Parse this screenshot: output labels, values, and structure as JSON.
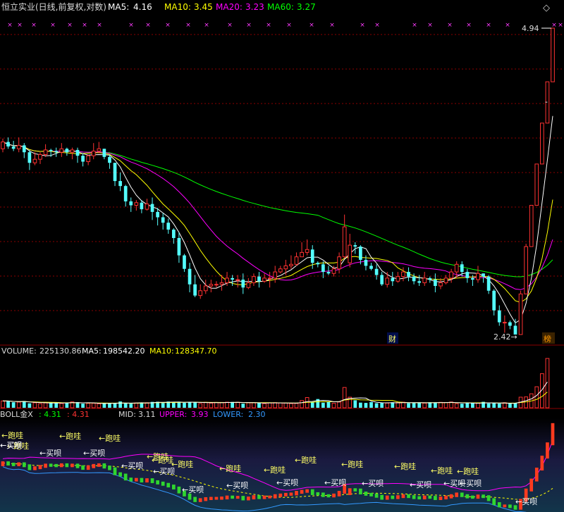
{
  "main_header": {
    "title": "恒立实业(日线,前复权,对数)",
    "ma5_label": "MA5:",
    "ma5_value": "4.16",
    "ma10_label": "MA10:",
    "ma10_value": "3.45",
    "ma20_label": "MA20:",
    "ma20_value": "3.23",
    "ma60_label": "MA60:",
    "ma60_value": "3.27"
  },
  "window_button": "◇",
  "annotations": {
    "high_label": "4.94",
    "low_label": "2.42→",
    "marker_cai": "财",
    "marker_bang": "榜",
    "dash_mark": "-"
  },
  "volume_header": {
    "label": "VOLUME:",
    "value": "225130.86",
    "ma5_label": "MA5:",
    "ma5_value": "198542.20",
    "ma10_label": "MA10:",
    "ma10_value": "128347.70"
  },
  "boll_header": {
    "label": "BOLL金X",
    "v1": ": 4.31",
    "v2": ": 4.31",
    "mid_label": "MID:",
    "mid_value": "3.11",
    "upper_label": "UPPER:",
    "upper_value": "3.93",
    "lower_label": "LOWER:",
    "lower_value": "2.30"
  },
  "boll_signals": [
    {
      "text": "←跑哇",
      "kind": "sell"
    },
    {
      "text": "←跑哇",
      "kind": "sell"
    },
    {
      "text": "←跑哇",
      "kind": "sell"
    },
    {
      "text": "←跑哇",
      "kind": "sell"
    },
    {
      "text": "←跑哇",
      "kind": "sell"
    },
    {
      "text": "←跑哇",
      "kind": "sell"
    },
    {
      "text": "←跑哇",
      "kind": "sell"
    },
    {
      "text": "←跑哇",
      "kind": "sell"
    },
    {
      "text": "←跑哇",
      "kind": "sell"
    },
    {
      "text": "←跑哇",
      "kind": "sell"
    },
    {
      "text": "←跑哇",
      "kind": "sell"
    },
    {
      "text": "←跑哇",
      "kind": "sell"
    },
    {
      "text": "←跑哇",
      "kind": "sell"
    },
    {
      "text": "←跑哇",
      "kind": "sell"
    },
    {
      "text": "←买呗",
      "kind": "buy"
    },
    {
      "text": "←买呗",
      "kind": "buy"
    },
    {
      "text": "←买呗",
      "kind": "buy"
    },
    {
      "text": "←买呗",
      "kind": "buy"
    },
    {
      "text": "←买呗",
      "kind": "buy"
    },
    {
      "text": "←买呗",
      "kind": "buy"
    },
    {
      "text": "←买呗",
      "kind": "buy"
    },
    {
      "text": "←买呗",
      "kind": "buy"
    },
    {
      "text": "←买呗",
      "kind": "buy"
    },
    {
      "text": "←买呗",
      "kind": "buy"
    },
    {
      "text": "←买呗",
      "kind": "buy"
    },
    {
      "text": "←买呗",
      "kind": "buy"
    },
    {
      "text": "←买呗",
      "kind": "buy"
    },
    {
      "text": "←买呗",
      "kind": "buy"
    },
    {
      "text": "←买呗",
      "kind": "buy"
    }
  ],
  "colors": {
    "up": "#ff3232",
    "down": "#54ffff",
    "ma5": "#ffffff",
    "ma10": "#ffff00",
    "ma20": "#ff00ff",
    "ma60": "#00ff00",
    "grid": "#8b0000",
    "upper": "#ff00ff",
    "lower": "#3399ff",
    "mid": "#ffff00"
  },
  "chart_data": {
    "type": "candlestick",
    "price_range": [
      2.42,
      4.94
    ],
    "candles": [
      [
        3.73,
        3.79,
        3.82,
        3.7
      ],
      [
        3.79,
        3.75,
        3.83,
        3.73
      ],
      [
        3.75,
        3.73,
        3.8,
        3.71
      ],
      [
        3.73,
        3.76,
        3.83,
        3.7
      ],
      [
        3.76,
        3.7,
        3.78,
        3.65
      ],
      [
        3.7,
        3.61,
        3.72,
        3.55
      ],
      [
        3.61,
        3.64,
        3.7,
        3.59
      ],
      [
        3.64,
        3.68,
        3.7,
        3.6
      ],
      [
        3.68,
        3.72,
        3.77,
        3.66
      ],
      [
        3.72,
        3.71,
        3.73,
        3.66
      ],
      [
        3.71,
        3.7,
        3.74,
        3.66
      ],
      [
        3.7,
        3.73,
        3.78,
        3.66
      ],
      [
        3.73,
        3.7,
        3.74,
        3.67
      ],
      [
        3.7,
        3.72,
        3.74,
        3.64
      ],
      [
        3.72,
        3.67,
        3.74,
        3.61
      ],
      [
        3.67,
        3.62,
        3.69,
        3.58
      ],
      [
        3.62,
        3.67,
        3.68,
        3.59
      ],
      [
        3.67,
        3.71,
        3.78,
        3.64
      ],
      [
        3.71,
        3.73,
        3.79,
        3.69
      ],
      [
        3.73,
        3.66,
        3.73,
        3.64
      ],
      [
        3.66,
        3.61,
        3.68,
        3.56
      ],
      [
        3.61,
        3.46,
        3.61,
        3.42
      ],
      [
        3.46,
        3.42,
        3.53,
        3.38
      ],
      [
        3.42,
        3.3,
        3.43,
        3.26
      ],
      [
        3.3,
        3.27,
        3.33,
        3.22
      ],
      [
        3.27,
        3.29,
        3.31,
        3.23
      ],
      [
        3.29,
        3.24,
        3.31,
        3.21
      ],
      [
        3.24,
        3.28,
        3.32,
        3.23
      ],
      [
        3.28,
        3.22,
        3.33,
        3.16
      ],
      [
        3.22,
        3.18,
        3.25,
        3.12
      ],
      [
        3.18,
        3.14,
        3.21,
        3.09
      ],
      [
        3.14,
        3.09,
        3.17,
        3.06
      ],
      [
        3.09,
        3.03,
        3.1,
        2.99
      ],
      [
        3.03,
        2.91,
        3.07,
        2.86
      ],
      [
        2.91,
        2.82,
        2.92,
        2.8
      ],
      [
        2.82,
        2.72,
        2.86,
        2.67
      ],
      [
        2.72,
        2.65,
        2.78,
        2.64
      ],
      [
        2.65,
        2.68,
        2.72,
        2.63
      ],
      [
        2.68,
        2.71,
        2.75,
        2.66
      ],
      [
        2.71,
        2.72,
        2.75,
        2.67
      ],
      [
        2.72,
        2.72,
        2.74,
        2.7
      ],
      [
        2.72,
        2.73,
        2.78,
        2.68
      ],
      [
        2.73,
        2.76,
        2.8,
        2.71
      ],
      [
        2.76,
        2.75,
        2.78,
        2.71
      ],
      [
        2.75,
        2.75,
        2.78,
        2.7
      ],
      [
        2.75,
        2.7,
        2.79,
        2.66
      ],
      [
        2.7,
        2.73,
        2.76,
        2.69
      ],
      [
        2.73,
        2.77,
        2.79,
        2.71
      ],
      [
        2.77,
        2.74,
        2.8,
        2.7
      ],
      [
        2.74,
        2.76,
        2.79,
        2.73
      ],
      [
        2.76,
        2.76,
        2.8,
        2.7
      ],
      [
        2.76,
        2.8,
        2.84,
        2.73
      ],
      [
        2.8,
        2.82,
        2.84,
        2.79
      ],
      [
        2.82,
        2.84,
        2.88,
        2.78
      ],
      [
        2.84,
        2.85,
        2.91,
        2.82
      ],
      [
        2.85,
        2.9,
        2.93,
        2.84
      ],
      [
        2.9,
        2.93,
        3.0,
        2.9
      ],
      [
        2.93,
        2.95,
        3.02,
        2.91
      ],
      [
        2.95,
        2.86,
        2.98,
        2.82
      ],
      [
        2.86,
        2.85,
        2.87,
        2.83
      ],
      [
        2.85,
        2.8,
        2.87,
        2.76
      ],
      [
        2.8,
        2.79,
        2.84,
        2.78
      ],
      [
        2.79,
        2.82,
        2.84,
        2.77
      ],
      [
        2.82,
        2.9,
        2.93,
        2.79
      ],
      [
        2.9,
        3.11,
        3.2,
        2.89
      ],
      [
        2.86,
        2.98,
        3.06,
        2.83
      ],
      [
        2.98,
        2.97,
        3.0,
        2.92
      ],
      [
        2.97,
        2.88,
        2.98,
        2.85
      ],
      [
        2.88,
        2.84,
        2.91,
        2.81
      ],
      [
        2.84,
        2.82,
        2.86,
        2.81
      ],
      [
        2.82,
        2.78,
        2.85,
        2.75
      ],
      [
        2.78,
        2.72,
        2.8,
        2.71
      ],
      [
        2.72,
        2.76,
        2.8,
        2.7
      ],
      [
        2.76,
        2.74,
        2.8,
        2.71
      ],
      [
        2.74,
        2.77,
        2.8,
        2.73
      ],
      [
        2.77,
        2.8,
        2.83,
        2.74
      ],
      [
        2.8,
        2.77,
        2.83,
        2.74
      ],
      [
        2.77,
        2.74,
        2.79,
        2.72
      ],
      [
        2.74,
        2.73,
        2.78,
        2.71
      ],
      [
        2.73,
        2.76,
        2.8,
        2.71
      ],
      [
        2.76,
        2.75,
        2.77,
        2.73
      ],
      [
        2.75,
        2.71,
        2.79,
        2.67
      ],
      [
        2.71,
        2.73,
        2.76,
        2.69
      ],
      [
        2.73,
        2.76,
        2.78,
        2.72
      ],
      [
        2.76,
        2.8,
        2.82,
        2.73
      ],
      [
        2.8,
        2.85,
        2.87,
        2.76
      ],
      [
        2.85,
        2.8,
        2.87,
        2.77
      ],
      [
        2.8,
        2.76,
        2.82,
        2.73
      ],
      [
        2.76,
        2.75,
        2.78,
        2.71
      ],
      [
        2.75,
        2.79,
        2.84,
        2.73
      ],
      [
        2.79,
        2.77,
        2.79,
        2.73
      ],
      [
        2.77,
        2.68,
        2.78,
        2.66
      ],
      [
        2.68,
        2.56,
        2.69,
        2.53
      ],
      [
        2.56,
        2.49,
        2.59,
        2.47
      ],
      [
        2.49,
        2.49,
        2.53,
        2.43
      ],
      [
        2.49,
        2.47,
        2.5,
        2.45
      ],
      [
        2.47,
        2.42,
        2.51,
        2.42
      ],
      [
        2.42,
        2.66,
        2.68,
        2.42
      ],
      [
        2.66,
        2.97,
        2.99,
        2.66
      ],
      [
        2.97,
        3.27,
        3.27,
        2.97
      ],
      [
        3.27,
        3.6,
        3.6,
        3.27
      ],
      [
        3.6,
        3.96,
        3.96,
        3.6
      ],
      [
        3.96,
        4.36,
        4.36,
        3.96
      ],
      [
        4.36,
        4.94,
        4.94,
        4.36
      ]
    ],
    "volume": [
      94000,
      93000,
      76000,
      78000,
      93000,
      61000,
      69000,
      57000,
      67000,
      73000,
      71000,
      59000,
      66000,
      81000,
      78000,
      57000,
      61000,
      62000,
      55000,
      63000,
      59000,
      60000,
      87000,
      61000,
      56000,
      67000,
      73000,
      70000,
      81000,
      83000,
      66000,
      86000,
      76000,
      84000,
      68000,
      77000,
      81000,
      58000,
      75000,
      64000,
      74000,
      74000,
      77000,
      80000,
      76000,
      57000,
      68000,
      69000,
      71000,
      58000,
      67000,
      71000,
      67000,
      65000,
      58000,
      60000,
      100000,
      141000,
      80000,
      120000,
      70000,
      79000,
      63000,
      79000,
      280000,
      146000,
      103000,
      71000,
      67000,
      78000,
      63000,
      67000,
      65000,
      75000,
      72000,
      77000,
      63000,
      66000,
      73000,
      64000,
      76000,
      70000,
      75000,
      73000,
      79000,
      56000,
      56000,
      70000,
      64000,
      63000,
      82000,
      60000,
      64000,
      57000,
      70000,
      57000,
      65000,
      146000,
      150000,
      193000,
      290000,
      470000,
      680000
    ],
    "boll_mid": [
      3.1,
      3.5
    ]
  }
}
